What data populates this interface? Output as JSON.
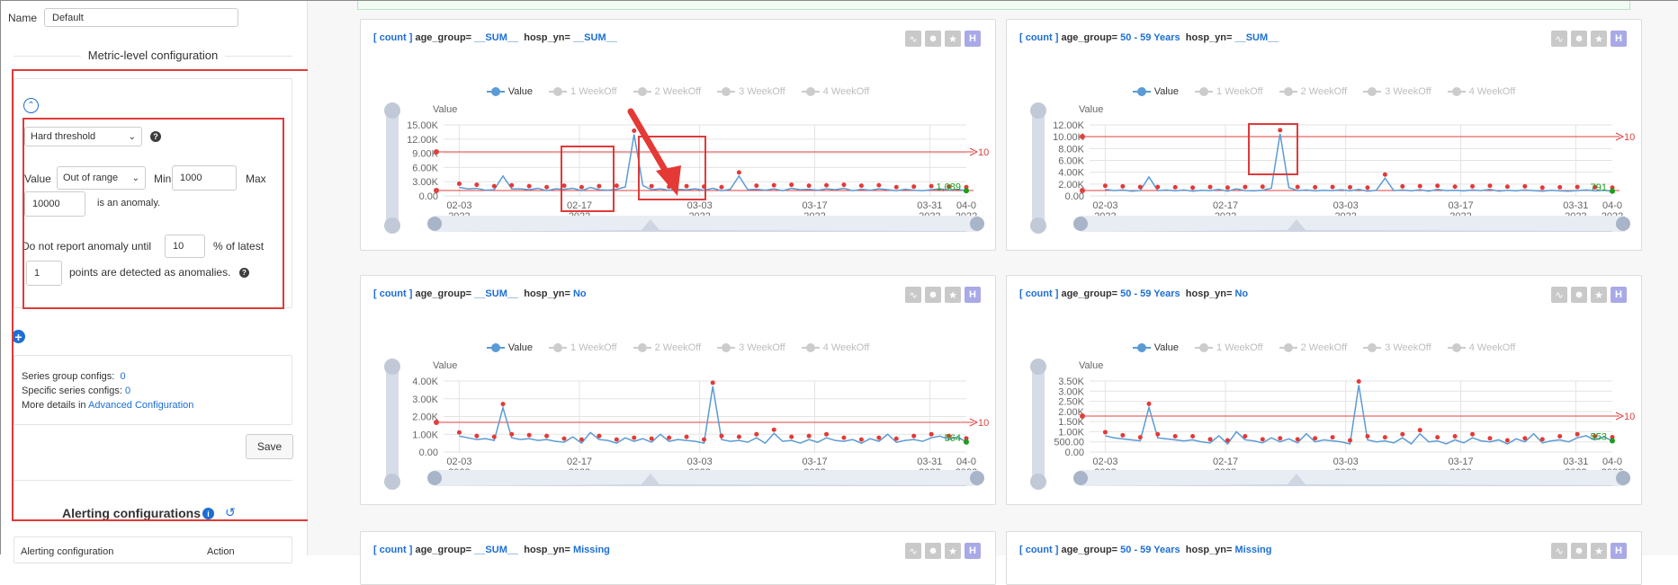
{
  "left": {
    "name_label": "Name",
    "name_value": "Default",
    "metric_section_title": "Metric-level configuration",
    "threshold_type": "Hard threshold",
    "value_label": "Value",
    "range_select": "Out of range",
    "min_label": "Min",
    "min_value": "1000",
    "max_label": "Max",
    "max_value": "10000",
    "anomaly_suffix": "is an anomaly.",
    "report_prefix": "Do not report anomaly until",
    "report_percent": "10",
    "report_percent_suffix": "% of latest",
    "report_points": "1",
    "report_points_suffix": "points are detected as anomalies.",
    "series_group_label": "Series group configs:",
    "series_group_count": "0",
    "specific_series_label": "Specific series configs:",
    "specific_series_count": "0",
    "more_details_label": "More details in",
    "advanced_link": "Advanced Configuration",
    "save_label": "Save",
    "alerting_title": "Alerting configurations",
    "alerting_col1": "Alerting configuration",
    "alerting_col2": "Action"
  },
  "legend": [
    "Value",
    "1 WeekOff",
    "2 WeekOff",
    "3 WeekOff",
    "4 WeekOff"
  ],
  "axis_title": "Value",
  "x_ticks": [
    {
      "date": "02-03",
      "year": "2022"
    },
    {
      "date": "02-17",
      "year": "2022"
    },
    {
      "date": "03-03",
      "year": "2022"
    },
    {
      "date": "03-17",
      "year": "2022"
    },
    {
      "date": "03-31",
      "year": "2022"
    },
    {
      "date": "04-0",
      "year": "2022"
    }
  ],
  "cards": [
    {
      "tag": "[ count ]",
      "k1": "age_group=",
      "v1": "__SUM__",
      "k2": "hosp_yn=",
      "v2": "__SUM__",
      "y_ticks": [
        "15.00K",
        "12.00K",
        "9.00K",
        "6.00K",
        "3.00K",
        "0.00"
      ],
      "last_value": "1,089",
      "threshold_label": "10"
    },
    {
      "tag": "[ count ]",
      "k1": "age_group=",
      "v1": "50 - 59 Years",
      "k2": "hosp_yn=",
      "v2": "__SUM__",
      "y_ticks": [
        "12.00K",
        "10.00K",
        "8.00K",
        "6.00K",
        "4.00K",
        "2.00K",
        "0.00"
      ],
      "last_value": "791",
      "threshold_label": "10"
    },
    {
      "tag": "[ count ]",
      "k1": "age_group=",
      "v1": "__SUM__",
      "k2": "hosp_yn=",
      "v2": "No",
      "y_ticks": [
        "4.00K",
        "3.00K",
        "2.00K",
        "1.00K",
        "0.00"
      ],
      "last_value": "564",
      "threshold_label": "10"
    },
    {
      "tag": "[ count ]",
      "k1": "age_group=",
      "v1": "50 - 59 Years",
      "k2": "hosp_yn=",
      "v2": "No",
      "y_ticks": [
        "3.50K",
        "3.00K",
        "2.50K",
        "2.00K",
        "1.50K",
        "1.00K",
        "500.00",
        "0.00"
      ],
      "last_value": "553",
      "threshold_label": "10"
    },
    {
      "tag": "[ count ]",
      "k1": "age_group=",
      "v1": "__SUM__",
      "k2": "hosp_yn=",
      "v2": "Missing"
    },
    {
      "tag": "[ count ]",
      "k1": "age_group=",
      "v1": "50 - 59 Years",
      "k2": "hosp_yn=",
      "v2": "Missing"
    }
  ],
  "chart_data": [
    {
      "type": "line",
      "title": "[ count ] age_group= __SUM__ hosp_yn= __SUM__",
      "ylim": [
        0,
        15000
      ],
      "series": [
        {
          "name": "Value",
          "values": [
            1800,
            1500,
            1600,
            1200,
            1300,
            4200,
            1500,
            1500,
            1300,
            1600,
            1100,
            1500,
            1400,
            1600,
            1100,
            1800,
            1300,
            1200,
            1400,
            1900,
            13000,
            2200,
            1300,
            1500,
            1200,
            1400,
            1300,
            1500,
            1200,
            1600,
            1100,
            1400,
            4200,
            1300,
            1400,
            1200,
            1500,
            1100,
            1600,
            1300,
            1400,
            1200,
            1500,
            1300,
            1600,
            1100,
            1400,
            1200,
            1500,
            1300,
            1100,
            1400,
            1200,
            1100,
            1300,
            1500,
            1200,
            1400,
            1089
          ]
        }
      ]
    },
    {
      "type": "line",
      "title": "[ count ] age_group= 50 - 59 Years hosp_yn= __SUM__",
      "ylim": [
        0,
        12000
      ],
      "series": [
        {
          "name": "Value",
          "values": [
            1100,
            900,
            1000,
            800,
            900,
            3200,
            900,
            1000,
            850,
            1000,
            800,
            950,
            900,
            1100,
            800,
            1200,
            900,
            850,
            950,
            1300,
            10500,
            1400,
            900,
            1000,
            850,
            950,
            900,
            1050,
            850,
            1100,
            800,
            950,
            3000,
            900,
            1000,
            850,
            1050,
            800,
            1100,
            900,
            950,
            850,
            1000,
            900,
            1100,
            800,
            950,
            850,
            1000,
            900,
            800,
            950,
            850,
            800,
            900,
            1000,
            850,
            950,
            791
          ]
        }
      ]
    },
    {
      "type": "line",
      "title": "[ count ] age_group= __SUM__ hosp_yn= No",
      "ylim": [
        0,
        4000
      ],
      "series": [
        {
          "name": "Value",
          "values": [
            900,
            800,
            700,
            750,
            650,
            2500,
            800,
            700,
            750,
            650,
            700,
            600,
            550,
            850,
            500,
            1100,
            700,
            650,
            500,
            800,
            600,
            750,
            550,
            1000,
            600,
            700,
            650,
            600,
            500,
            3700,
            700,
            600,
            650,
            550,
            800,
            500,
            1050,
            600,
            650,
            500,
            700,
            550,
            800,
            650,
            600,
            700,
            500,
            750,
            600,
            1000,
            550,
            650,
            700,
            600,
            800,
            900,
            700,
            850,
            564
          ]
        }
      ]
    },
    {
      "type": "line",
      "title": "[ count ] age_group= 50 - 59 Years hosp_yn= No",
      "ylim": [
        0,
        3500
      ],
      "series": [
        {
          "name": "Value",
          "values": [
            800,
            700,
            650,
            600,
            550,
            2200,
            700,
            650,
            600,
            550,
            600,
            500,
            450,
            800,
            400,
            1000,
            600,
            550,
            450,
            700,
            500,
            650,
            450,
            900,
            500,
            600,
            550,
            500,
            400,
            3300,
            600,
            500,
            550,
            450,
            700,
            400,
            900,
            500,
            550,
            400,
            600,
            450,
            700,
            550,
            500,
            600,
            400,
            650,
            500,
            900,
            450,
            550,
            600,
            500,
            700,
            800,
            600,
            750,
            553
          ]
        }
      ]
    }
  ]
}
